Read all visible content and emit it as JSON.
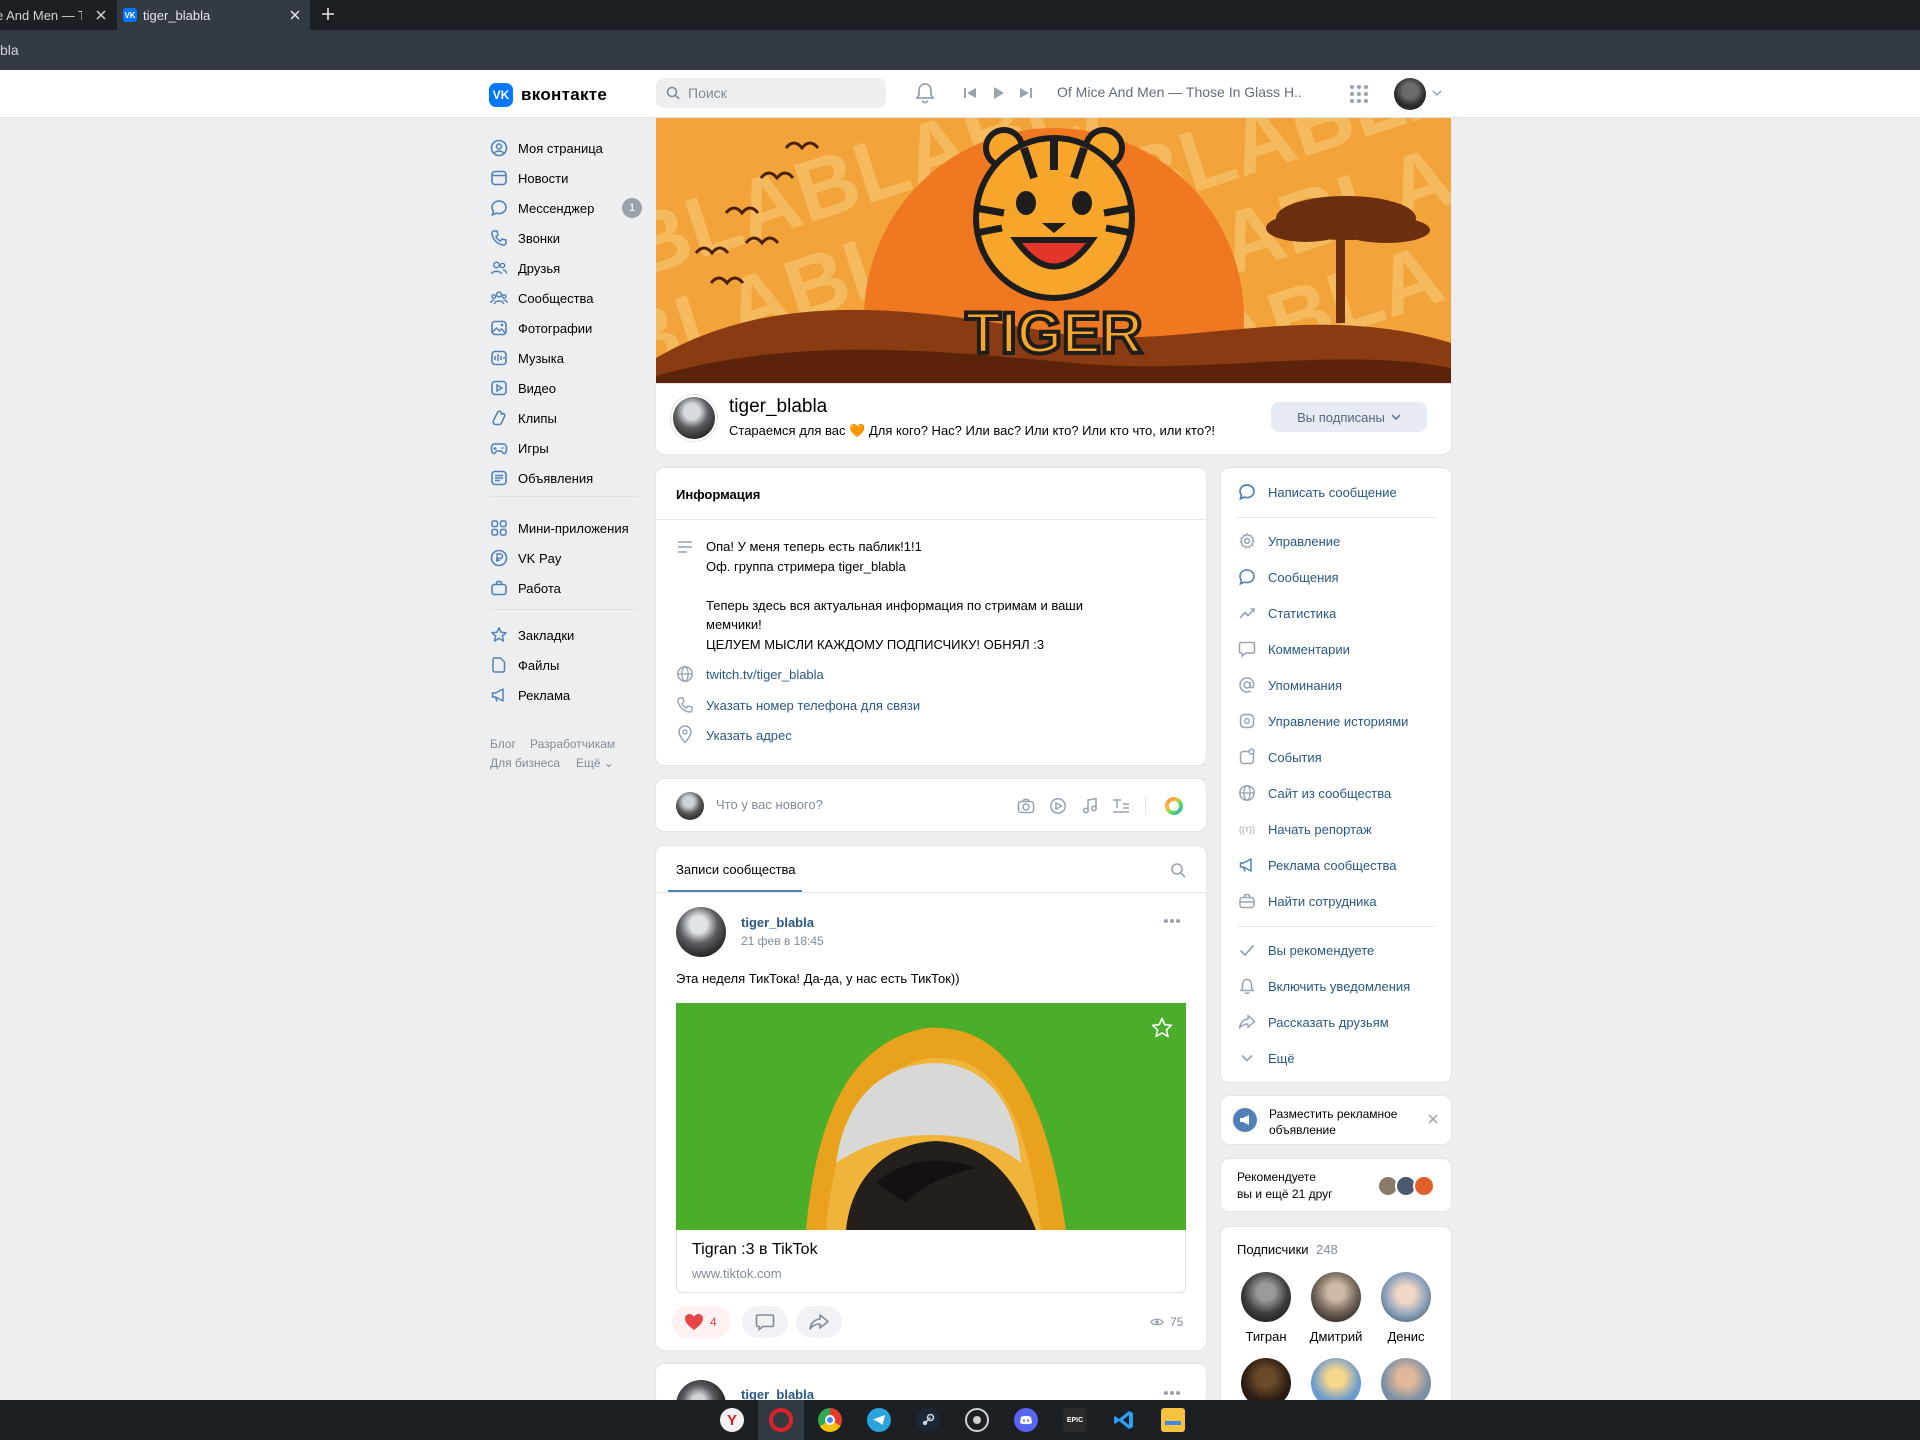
{
  "browser": {
    "tabs": [
      {
        "title": "e And Men — Th"
      },
      {
        "title": "tiger_blabla",
        "favicon": "VK"
      }
    ],
    "address": "bla"
  },
  "header": {
    "logo_text": "вконтакте",
    "logo_mark": "VK",
    "search_placeholder": "Поиск",
    "now_playing": "Of Mice And Men — Those In Glass H..."
  },
  "nav": {
    "items": [
      {
        "label": "Моя страница",
        "icon": "user-circle-icon"
      },
      {
        "label": "Новости",
        "icon": "news-icon"
      },
      {
        "label": "Мессенджер",
        "icon": "chat-icon",
        "badge": "1"
      },
      {
        "label": "Звонки",
        "icon": "phone-icon"
      },
      {
        "label": "Друзья",
        "icon": "friends-icon"
      },
      {
        "label": "Сообщества",
        "icon": "communities-icon"
      },
      {
        "label": "Фотографии",
        "icon": "photo-icon"
      },
      {
        "label": "Музыка",
        "icon": "music-icon"
      },
      {
        "label": "Видео",
        "icon": "video-icon"
      },
      {
        "label": "Клипы",
        "icon": "clips-icon"
      },
      {
        "label": "Игры",
        "icon": "games-icon"
      },
      {
        "label": "Объявления",
        "icon": "classifieds-icon"
      }
    ],
    "items2": [
      {
        "label": "Мини-приложения",
        "icon": "apps-icon"
      },
      {
        "label": "VK Pay",
        "icon": "vkpay-icon"
      },
      {
        "label": "Работа",
        "icon": "work-icon"
      }
    ],
    "items3": [
      {
        "label": "Закладки",
        "icon": "star-icon"
      },
      {
        "label": "Файлы",
        "icon": "file-icon"
      },
      {
        "label": "Реклама",
        "icon": "megaphone-icon"
      }
    ],
    "footer": {
      "blog": "Блог",
      "devs": "Разработчикам",
      "business": "Для бизнеса",
      "more": "Ещё"
    }
  },
  "group": {
    "cover_text": "TIGER",
    "name": "tiger_blabla",
    "status": "Стараемся для вас 🧡 Для кого? Нас? Или вас? Или кто? Или кто что, или кто?!",
    "subscribed_label": "Вы подписаны"
  },
  "info": {
    "title": "Информация",
    "description": [
      "Опа! У меня теперь есть паблик!1!1",
      "Оф. группа стримера tiger_blabla",
      "",
      "Теперь здесь вся актуальная информация по стримам и ваши",
      "мемчики!",
      "ЦЕЛУЕМ МЫСЛИ КАЖДОМУ ПОДПИСЧИКУ! ОБНЯЛ :3"
    ],
    "website": "twitch.tv/tiger_blabla",
    "phone_prompt": "Указать номер телефона для связи",
    "address_prompt": "Указать адрес"
  },
  "postbox": {
    "placeholder": "Что у вас нового?"
  },
  "wall": {
    "tab_label": "Записи сообщества",
    "posts": [
      {
        "author": "tiger_blabla",
        "date": "21 фев в 18:45",
        "text": "Эта неделя ТикТока! Да-да, у нас есть ТикТок))",
        "link_title": "Tigran :3 в TikTok",
        "link_url": "www.tiktok.com",
        "likes": "4",
        "views": "75"
      },
      {
        "author": "tiger_blabla"
      }
    ]
  },
  "actions": [
    {
      "label": "Написать сообщение",
      "icon": "message-icon"
    },
    {
      "label": "Управление",
      "icon": "gear-icon"
    },
    {
      "label": "Сообщения",
      "icon": "chat-icon"
    },
    {
      "label": "Статистика",
      "icon": "stats-icon"
    },
    {
      "label": "Комментарии",
      "icon": "comment-icon"
    },
    {
      "label": "Упоминания",
      "icon": "at-icon"
    },
    {
      "label": "Управление историями",
      "icon": "stories-icon"
    },
    {
      "label": "События",
      "icon": "event-icon"
    },
    {
      "label": "Сайт из сообщества",
      "icon": "globe-icon"
    },
    {
      "label": "Начать репортаж",
      "icon": "broadcast-icon"
    },
    {
      "label": "Реклама сообщества",
      "icon": "megaphone-icon"
    },
    {
      "label": "Найти сотрудника",
      "icon": "briefcase-icon"
    },
    {
      "label": "Вы рекомендуете",
      "icon": "check-icon"
    },
    {
      "label": "Включить уведомления",
      "icon": "bell-icon"
    },
    {
      "label": "Рассказать друзьям",
      "icon": "share-icon"
    },
    {
      "label": "Ещё",
      "icon": "chevron-down-icon"
    }
  ],
  "ad_prompt": {
    "text": "Разместить рекламное объявление"
  },
  "recommend": {
    "line1": "Рекомендуете",
    "line2": "вы и ещё 21 друг"
  },
  "subscribers": {
    "title": "Подписчики",
    "count": "248",
    "people": [
      {
        "name": "Тигран"
      },
      {
        "name": "Дмитрий"
      },
      {
        "name": "Денис"
      }
    ]
  },
  "colors": {
    "accent": "#0077ff",
    "link": "#2a5885",
    "cover": "#f2a43a",
    "sun": "#f07820",
    "hills": "#6b2e0e"
  }
}
